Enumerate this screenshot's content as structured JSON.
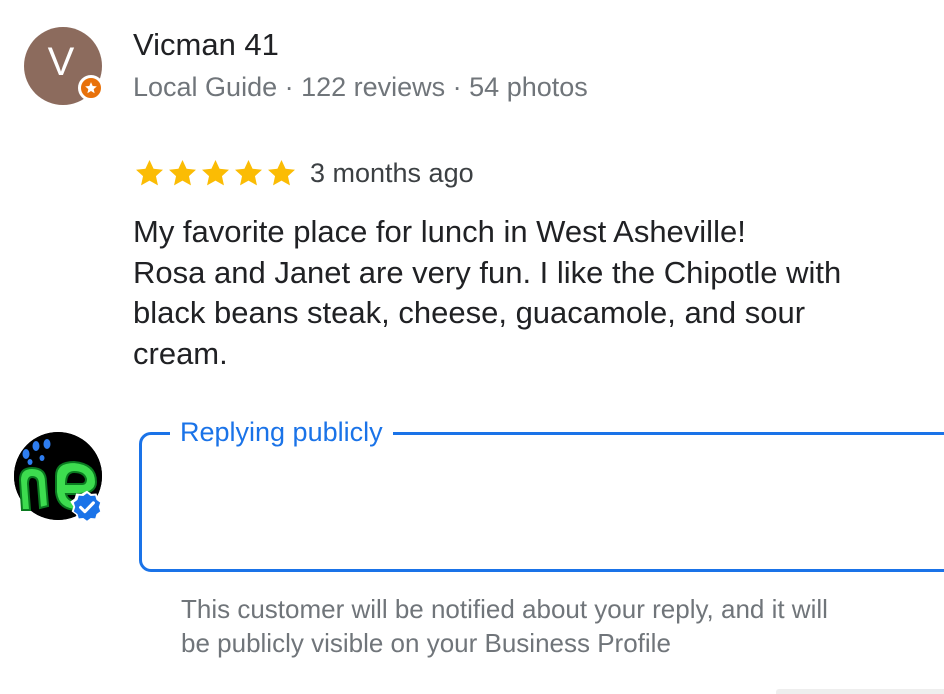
{
  "reviewer": {
    "avatar_letter": "V",
    "name": "Vicman 41",
    "meta": "Local Guide · 122 reviews · 54 photos"
  },
  "review": {
    "rating": 5,
    "rating_max": 5,
    "time": "3 months ago",
    "lines": [
      "My favorite place for lunch in West Asheville!",
      "Rosa and Janet are very fun. I like the Chipotle with",
      "black beans steak, cheese, guacamole, and sour",
      "cream."
    ]
  },
  "reply": {
    "label": "Replying publicly",
    "value": "",
    "notice_lines": [
      "This customer will be notified about your reply, and it will",
      "be publicly visible on your Business Profile"
    ]
  },
  "colors": {
    "accent": "#1a73e8",
    "star": "#fbbc04",
    "guide_badge": "#e8710a",
    "avatar_bg": "#8c6b5d",
    "secondary_text": "#70757a"
  },
  "icons": {
    "guide_badge": "local-guide-star-icon",
    "star": "star-icon",
    "verified": "verified-check-icon"
  }
}
